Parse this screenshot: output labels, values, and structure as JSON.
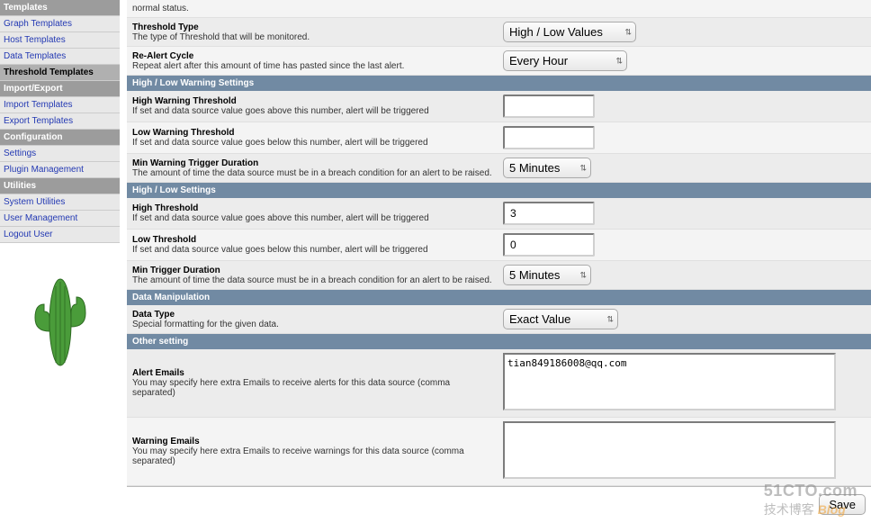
{
  "sidebar": {
    "sections": [
      {
        "type": "header",
        "label": "Templates"
      },
      {
        "type": "item",
        "label": "Graph Templates"
      },
      {
        "type": "item",
        "label": "Host Templates"
      },
      {
        "type": "item",
        "label": "Data Templates"
      },
      {
        "type": "item",
        "label": "Threshold Templates",
        "selected": true
      },
      {
        "type": "header",
        "label": "Import/Export"
      },
      {
        "type": "item",
        "label": "Import Templates"
      },
      {
        "type": "item",
        "label": "Export Templates"
      },
      {
        "type": "header",
        "label": "Configuration"
      },
      {
        "type": "item",
        "label": "Settings"
      },
      {
        "type": "item",
        "label": "Plugin Management"
      },
      {
        "type": "header",
        "label": "Utilities"
      },
      {
        "type": "item",
        "label": "System Utilities"
      },
      {
        "type": "item",
        "label": "User Management"
      },
      {
        "type": "item",
        "label": "Logout User"
      }
    ]
  },
  "restoral_desc": "normal status.",
  "threshold_type": {
    "label": "Threshold Type",
    "desc": "The type of Threshold that will be monitored.",
    "value": "High / Low Values"
  },
  "realert_cycle": {
    "label": "Re-Alert Cycle",
    "desc": "Repeat alert after this amount of time has pasted since the last alert.",
    "value": "Every Hour"
  },
  "section_hl_warning": "High / Low Warning Settings",
  "high_warning": {
    "label": "High Warning Threshold",
    "desc": "If set and data source value goes above this number, alert will be triggered",
    "value": ""
  },
  "low_warning": {
    "label": "Low Warning Threshold",
    "desc": "If set and data source value goes below this number, alert will be triggered",
    "value": ""
  },
  "min_warning_trigger": {
    "label": "Min Warning Trigger Duration",
    "desc": "The amount of time the data source must be in a breach condition for an alert to be raised.",
    "value": "5 Minutes"
  },
  "section_hl": "High / Low Settings",
  "high_threshold": {
    "label": "High Threshold",
    "desc": "If set and data source value goes above this number, alert will be triggered",
    "value": "3"
  },
  "low_threshold": {
    "label": "Low Threshold",
    "desc": "If set and data source value goes below this number, alert will be triggered",
    "value": "0"
  },
  "min_trigger": {
    "label": "Min Trigger Duration",
    "desc": "The amount of time the data source must be in a breach condition for an alert to be raised.",
    "value": "5 Minutes"
  },
  "section_data_manip": "Data Manipulation",
  "data_type": {
    "label": "Data Type",
    "desc": "Special formatting for the given data.",
    "value": "Exact Value"
  },
  "section_other": "Other setting",
  "alert_emails": {
    "label": "Alert Emails",
    "desc": "You may specify here extra Emails to receive alerts for this data source (comma separated)",
    "value": "tian849186008@qq.com"
  },
  "warning_emails": {
    "label": "Warning Emails",
    "desc": "You may specify here extra Emails to receive warnings for this data source (comma separated)",
    "value": ""
  },
  "save_label": "Save",
  "watermark": {
    "line1": "51CTO.com",
    "line2_a": "技术博客",
    "line2_b": "Blog"
  }
}
